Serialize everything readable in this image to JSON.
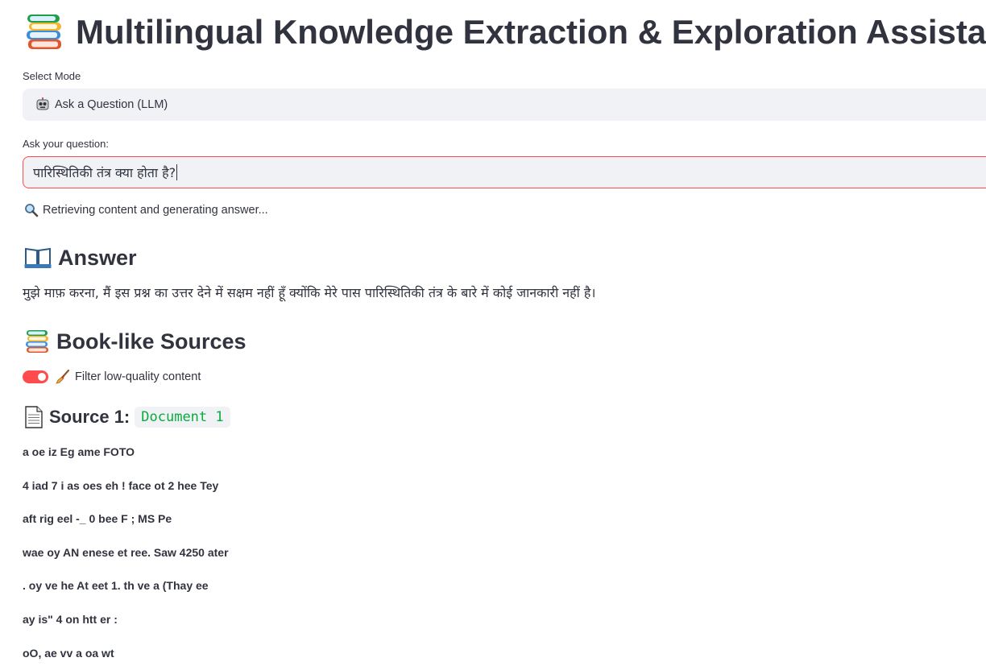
{
  "header": {
    "title": "Multilingual Knowledge Extraction & Exploration Assistant",
    "title_icon": "books-icon"
  },
  "mode": {
    "label": "Select Mode",
    "selected_icon": "robot-icon",
    "selected": "Ask a Question (LLM)"
  },
  "question": {
    "label": "Ask your question:",
    "value": "पारिस्थितिकी तंत्र क्या होता है?"
  },
  "status": {
    "icon": "magnifier-icon",
    "text": "Retrieving content and generating answer..."
  },
  "answer": {
    "icon": "open-book-icon",
    "heading": "Answer",
    "text": "मुझे माफ़ करना, मैं इस प्रश्न का उत्तर देने में सक्षम नहीं हूँ क्योंकि मेरे पास पारिस्थितिकी तंत्र के बारे में कोई जानकारी नहीं है।"
  },
  "sources": {
    "icon": "books-icon",
    "heading": "Book-like Sources",
    "filter": {
      "enabled": true,
      "icon": "broom-icon",
      "label": "Filter low-quality content"
    },
    "items": [
      {
        "icon": "page-icon",
        "prefix": "Source 1:",
        "name": "Document 1",
        "lines": [
          "a oe iz Eg ame FOTO",
          "4 iad 7 i as oes eh ! face ot 2 hee Tey",
          "aft rig eel -_ 0 bee F ; MS Pe",
          "wae oy AN enese et ree. Saw 4250 ater",
          ". oy ve he At eet 1. th ve a (Thay ee",
          "ay is\" 4 on htt er :",
          "oO, ae vv a oa wt"
        ]
      }
    ]
  },
  "colors": {
    "accent": "#ff4b4b",
    "code_green": "#09ab3b",
    "input_bg": "#f0f2f6",
    "text": "#31333f"
  }
}
